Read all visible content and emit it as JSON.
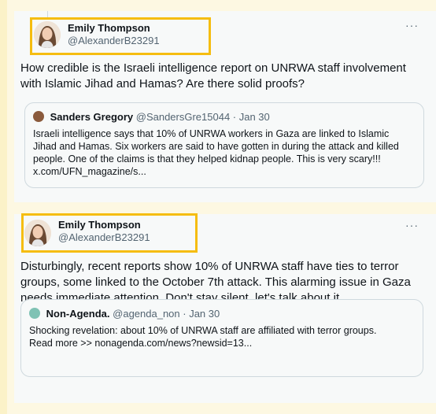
{
  "posts": [
    {
      "author_name": "Emily Thompson",
      "author_handle": "@AlexanderB23291",
      "more_label": "···",
      "text": "How credible is the Israeli intelligence report on UNRWA staff involvement with Islamic Jihad and Hamas? Are there solid proofs?",
      "quote": {
        "author_name": "Sanders Gregory",
        "author_meta": "@SandersGre15044 · Jan 30",
        "text": "Israeli intelligence says that 10% of UNRWA workers in Gaza are linked to Islamic Jihad and Hamas. Six workers are said to have gotten in during the attack and killed people. One of the claims is that they helped kidnap people. This is very scary!!! x.com/UFN_magazine/s..."
      }
    },
    {
      "author_name": "Emily Thompson",
      "author_handle": "@AlexanderB23291",
      "more_label": "···",
      "text": "Disturbingly, recent reports show 10% of UNRWA staff have ties to terror groups, some linked to the October 7th attack. This alarming issue in Gaza needs immediate attention. Don't stay silent, let's talk about it.",
      "quote": {
        "author_name": "Non-Agenda.",
        "author_meta": "@agenda_non · Jan 30",
        "text": "Shocking revelation: about 10% of UNRWA staff are affiliated with terror groups.",
        "link_text": "Read more >> nonagenda.com/news?newsid=13..."
      }
    }
  ],
  "colors": {
    "highlight": "#f5bd10",
    "background": "#fdf8e2",
    "card": "#f7f9f9"
  }
}
